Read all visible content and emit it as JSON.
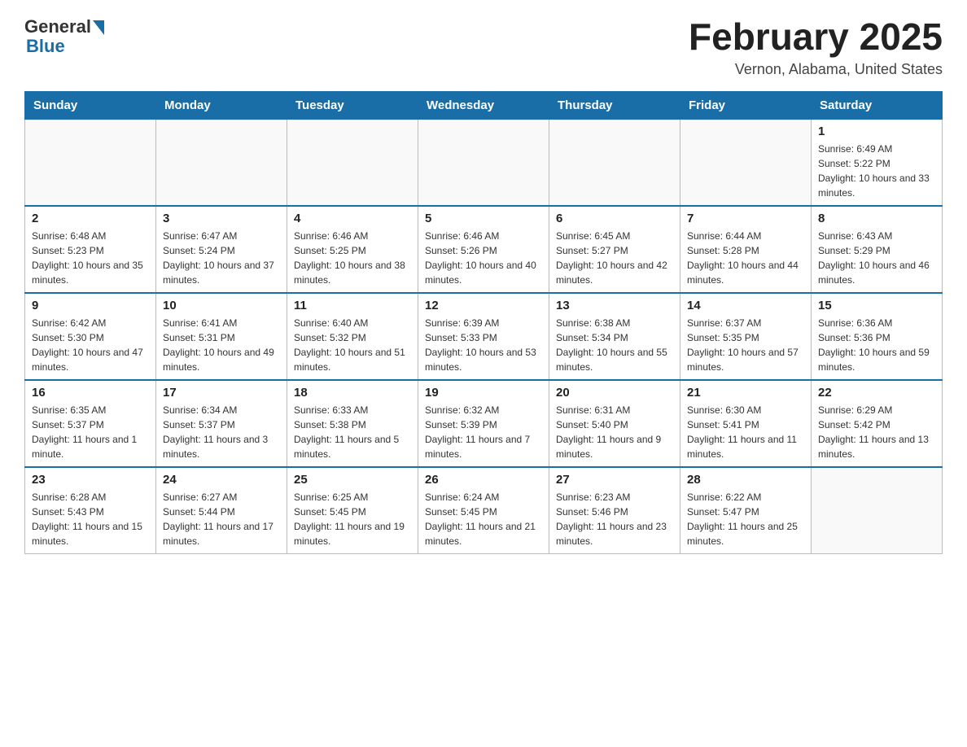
{
  "logo": {
    "general": "General",
    "blue": "Blue"
  },
  "header": {
    "title": "February 2025",
    "location": "Vernon, Alabama, United States"
  },
  "days_of_week": [
    "Sunday",
    "Monday",
    "Tuesday",
    "Wednesday",
    "Thursday",
    "Friday",
    "Saturday"
  ],
  "weeks": [
    {
      "days": [
        {
          "num": "",
          "info": ""
        },
        {
          "num": "",
          "info": ""
        },
        {
          "num": "",
          "info": ""
        },
        {
          "num": "",
          "info": ""
        },
        {
          "num": "",
          "info": ""
        },
        {
          "num": "",
          "info": ""
        },
        {
          "num": "1",
          "info": "Sunrise: 6:49 AM\nSunset: 5:22 PM\nDaylight: 10 hours and 33 minutes."
        }
      ]
    },
    {
      "days": [
        {
          "num": "2",
          "info": "Sunrise: 6:48 AM\nSunset: 5:23 PM\nDaylight: 10 hours and 35 minutes."
        },
        {
          "num": "3",
          "info": "Sunrise: 6:47 AM\nSunset: 5:24 PM\nDaylight: 10 hours and 37 minutes."
        },
        {
          "num": "4",
          "info": "Sunrise: 6:46 AM\nSunset: 5:25 PM\nDaylight: 10 hours and 38 minutes."
        },
        {
          "num": "5",
          "info": "Sunrise: 6:46 AM\nSunset: 5:26 PM\nDaylight: 10 hours and 40 minutes."
        },
        {
          "num": "6",
          "info": "Sunrise: 6:45 AM\nSunset: 5:27 PM\nDaylight: 10 hours and 42 minutes."
        },
        {
          "num": "7",
          "info": "Sunrise: 6:44 AM\nSunset: 5:28 PM\nDaylight: 10 hours and 44 minutes."
        },
        {
          "num": "8",
          "info": "Sunrise: 6:43 AM\nSunset: 5:29 PM\nDaylight: 10 hours and 46 minutes."
        }
      ]
    },
    {
      "days": [
        {
          "num": "9",
          "info": "Sunrise: 6:42 AM\nSunset: 5:30 PM\nDaylight: 10 hours and 47 minutes."
        },
        {
          "num": "10",
          "info": "Sunrise: 6:41 AM\nSunset: 5:31 PM\nDaylight: 10 hours and 49 minutes."
        },
        {
          "num": "11",
          "info": "Sunrise: 6:40 AM\nSunset: 5:32 PM\nDaylight: 10 hours and 51 minutes."
        },
        {
          "num": "12",
          "info": "Sunrise: 6:39 AM\nSunset: 5:33 PM\nDaylight: 10 hours and 53 minutes."
        },
        {
          "num": "13",
          "info": "Sunrise: 6:38 AM\nSunset: 5:34 PM\nDaylight: 10 hours and 55 minutes."
        },
        {
          "num": "14",
          "info": "Sunrise: 6:37 AM\nSunset: 5:35 PM\nDaylight: 10 hours and 57 minutes."
        },
        {
          "num": "15",
          "info": "Sunrise: 6:36 AM\nSunset: 5:36 PM\nDaylight: 10 hours and 59 minutes."
        }
      ]
    },
    {
      "days": [
        {
          "num": "16",
          "info": "Sunrise: 6:35 AM\nSunset: 5:37 PM\nDaylight: 11 hours and 1 minute."
        },
        {
          "num": "17",
          "info": "Sunrise: 6:34 AM\nSunset: 5:37 PM\nDaylight: 11 hours and 3 minutes."
        },
        {
          "num": "18",
          "info": "Sunrise: 6:33 AM\nSunset: 5:38 PM\nDaylight: 11 hours and 5 minutes."
        },
        {
          "num": "19",
          "info": "Sunrise: 6:32 AM\nSunset: 5:39 PM\nDaylight: 11 hours and 7 minutes."
        },
        {
          "num": "20",
          "info": "Sunrise: 6:31 AM\nSunset: 5:40 PM\nDaylight: 11 hours and 9 minutes."
        },
        {
          "num": "21",
          "info": "Sunrise: 6:30 AM\nSunset: 5:41 PM\nDaylight: 11 hours and 11 minutes."
        },
        {
          "num": "22",
          "info": "Sunrise: 6:29 AM\nSunset: 5:42 PM\nDaylight: 11 hours and 13 minutes."
        }
      ]
    },
    {
      "days": [
        {
          "num": "23",
          "info": "Sunrise: 6:28 AM\nSunset: 5:43 PM\nDaylight: 11 hours and 15 minutes."
        },
        {
          "num": "24",
          "info": "Sunrise: 6:27 AM\nSunset: 5:44 PM\nDaylight: 11 hours and 17 minutes."
        },
        {
          "num": "25",
          "info": "Sunrise: 6:25 AM\nSunset: 5:45 PM\nDaylight: 11 hours and 19 minutes."
        },
        {
          "num": "26",
          "info": "Sunrise: 6:24 AM\nSunset: 5:45 PM\nDaylight: 11 hours and 21 minutes."
        },
        {
          "num": "27",
          "info": "Sunrise: 6:23 AM\nSunset: 5:46 PM\nDaylight: 11 hours and 23 minutes."
        },
        {
          "num": "28",
          "info": "Sunrise: 6:22 AM\nSunset: 5:47 PM\nDaylight: 11 hours and 25 minutes."
        },
        {
          "num": "",
          "info": ""
        }
      ]
    }
  ]
}
